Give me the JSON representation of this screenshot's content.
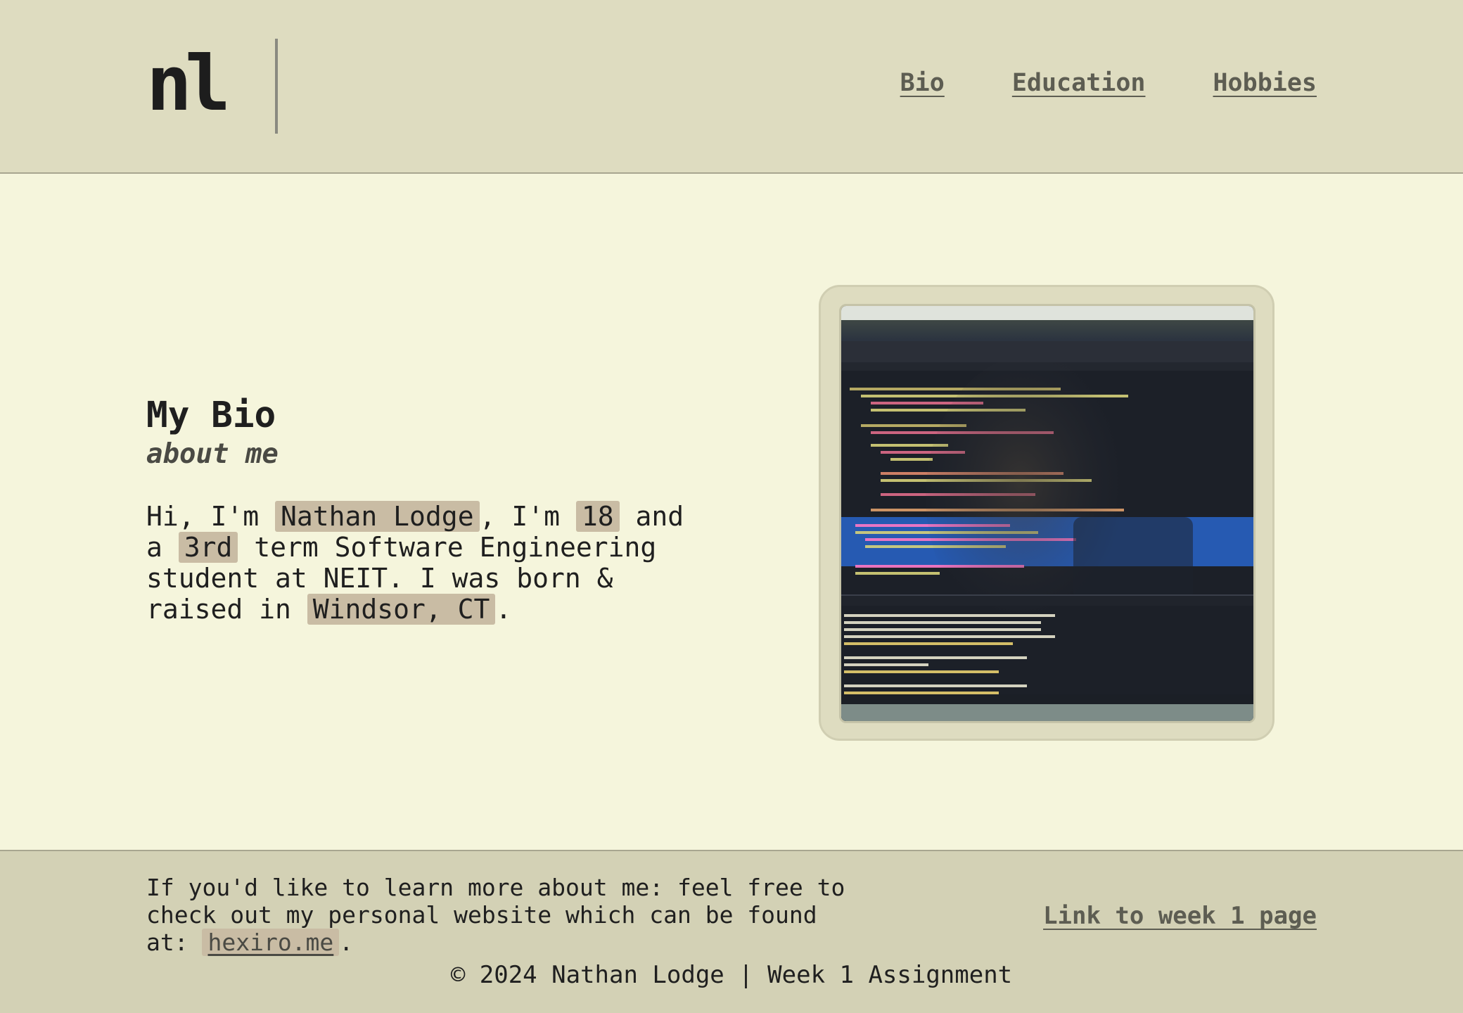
{
  "header": {
    "logo": "nl",
    "nav": [
      {
        "label": "Bio"
      },
      {
        "label": "Education"
      },
      {
        "label": "Hobbies"
      }
    ]
  },
  "bio": {
    "title": "My Bio",
    "subtitle": "about me",
    "text_1": "Hi, I'm ",
    "name": "Nathan Lodge",
    "text_2": ", I'm ",
    "age": "18",
    "text_3": " and a ",
    "term": "3rd",
    "text_4": " term Software Engineering student at NEIT. I was born & raised in ",
    "hometown": "Windsor, CT",
    "text_5": "."
  },
  "photo": {
    "subject": "Laptop screen showing code editor with reflection"
  },
  "footer": {
    "text_1": "If you'd like to learn more about me: feel free to check out my personal website which can be found at: ",
    "website": "hexiro.me",
    "text_2": ".",
    "week_link": "Link to week 1 page",
    "copyright": "© 2024 Nathan Lodge | Week 1 Assignment"
  },
  "colors": {
    "header_bg": "#dedcc0",
    "page_bg": "#f5f5dc",
    "footer_bg": "#d3d1b5",
    "highlight": "#c9bca4",
    "link": "#5d5d52"
  }
}
